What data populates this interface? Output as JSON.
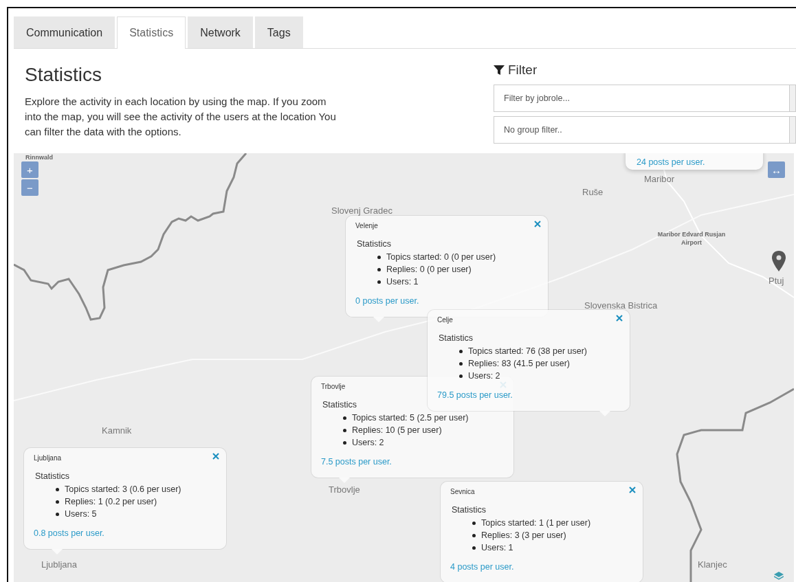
{
  "tabs": [
    {
      "label": "Communication",
      "selected": false
    },
    {
      "label": "Statistics",
      "selected": true
    },
    {
      "label": "Network",
      "selected": false
    },
    {
      "label": "Tags",
      "selected": false
    }
  ],
  "heading": "Statistics",
  "description": "Explore the activity in each location by using the map. If you zoom into the map, you will see the activity of the users at the location You can filter the data with the options.",
  "filter": {
    "title": "Filter",
    "fields": [
      {
        "placeholder": "Filter by jobrole..."
      },
      {
        "placeholder": "No group filter.."
      }
    ]
  },
  "map": {
    "zoom_in": "+",
    "zoom_out": "−",
    "expand": "↔",
    "labels": [
      {
        "text": "Rinnwald",
        "kind": "poi"
      },
      {
        "text": "Slovenj Gradec",
        "kind": "town"
      },
      {
        "text": "Maribor",
        "kind": "town"
      },
      {
        "text": "Ruše",
        "kind": "town"
      },
      {
        "text": "Maribor Edvard Rusjan Airport",
        "kind": "poi"
      },
      {
        "text": "Ptuj",
        "kind": "town"
      },
      {
        "text": "Slovenska Bistrica",
        "kind": "town"
      },
      {
        "text": "Kamnik",
        "kind": "town"
      },
      {
        "text": "Trbovlje",
        "kind": "town"
      },
      {
        "text": "Ljubljana",
        "kind": "town"
      },
      {
        "text": "Klanjec",
        "kind": "town"
      }
    ],
    "partial_popup": {
      "link": "24 posts per user."
    },
    "popups": [
      {
        "title": "Velenje",
        "heading": "Statistics",
        "items": [
          "Topics started: 0 (0 per user)",
          "Replies: 0 (0 per user)",
          "Users: 1"
        ],
        "link": "0 posts per user."
      },
      {
        "title": "Trbovlje",
        "heading": "Statistics",
        "items": [
          "Topics started: 5 (2.5 per user)",
          "Replies: 10 (5 per user)",
          "Users: 2"
        ],
        "link": "7.5 posts per user."
      },
      {
        "title": "Celje",
        "heading": "Statistics",
        "items": [
          "Topics started: 76 (38 per user)",
          "Replies: 83 (41.5 per user)",
          "Users: 2"
        ],
        "link": "79.5 posts per user."
      },
      {
        "title": "Ljubljana",
        "heading": "Statistics",
        "items": [
          "Topics started: 3 (0.6 per user)",
          "Replies: 1 (0.2 per user)",
          "Users: 5"
        ],
        "link": "0.8 posts per user."
      },
      {
        "title": "Sevnica",
        "heading": "Statistics",
        "items": [
          "Topics started: 1 (1 per user)",
          "Replies: 3 (3 per user)",
          "Users: 1"
        ],
        "link": "4 posts per user."
      }
    ]
  }
}
